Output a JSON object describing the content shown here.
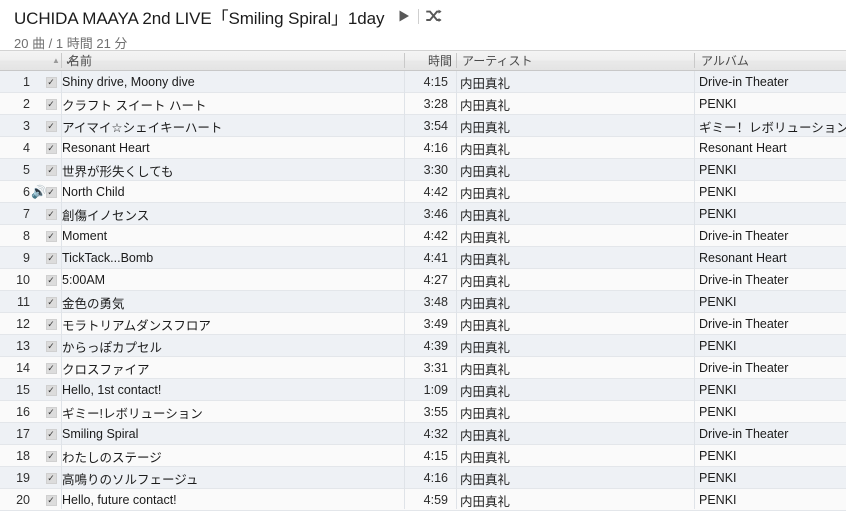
{
  "header": {
    "album_title": "UCHIDA MAAYA 2nd LIVE「Smiling  Spiral」1day",
    "subtitle": "20 曲 / 1 時間 21 分",
    "play_icon": "play-icon",
    "shuffle_icon": "shuffle-icon"
  },
  "columns": {
    "sort_arrow": "▲",
    "check": "✓",
    "name": "名前",
    "time": "時間",
    "artist": "アーティスト",
    "album": "アルバム"
  },
  "colors": {
    "row_odd": "#eef1f5",
    "row_even": "#fafafa",
    "header_bg": "#ececec",
    "text": "#1b1b1b",
    "subtitle_text": "#707070"
  },
  "tracks": [
    {
      "num": "1",
      "checked": "✓",
      "playing": "",
      "name": "Shiny drive, Moony dive",
      "time": "4:15",
      "artist": "内田真礼",
      "album": "Drive-in Theater"
    },
    {
      "num": "2",
      "checked": "✓",
      "playing": "",
      "name": "クラフト スイート ハート",
      "time": "3:28",
      "artist": "内田真礼",
      "album": "PENKI"
    },
    {
      "num": "3",
      "checked": "✓",
      "playing": "",
      "name": "アイマイ☆シェイキーハート",
      "time": "3:54",
      "artist": "内田真礼",
      "album": "ギミー！レボリューション"
    },
    {
      "num": "4",
      "checked": "✓",
      "playing": "",
      "name": "Resonant Heart",
      "time": "4:16",
      "artist": "内田真礼",
      "album": "Resonant Heart"
    },
    {
      "num": "5",
      "checked": "✓",
      "playing": "",
      "name": "世界が形失くしても",
      "time": "3:30",
      "artist": "内田真礼",
      "album": "PENKI"
    },
    {
      "num": "6",
      "checked": "✓",
      "playing": "🔊",
      "name": "North Child",
      "time": "4:42",
      "artist": "内田真礼",
      "album": "PENKI"
    },
    {
      "num": "7",
      "checked": "✓",
      "playing": "",
      "name": "創傷イノセンス",
      "time": "3:46",
      "artist": "内田真礼",
      "album": "PENKI"
    },
    {
      "num": "8",
      "checked": "✓",
      "playing": "",
      "name": "Moment",
      "time": "4:42",
      "artist": "内田真礼",
      "album": "Drive-in Theater"
    },
    {
      "num": "9",
      "checked": "✓",
      "playing": "",
      "name": "TickTack...Bomb",
      "time": "4:41",
      "artist": "内田真礼",
      "album": "Resonant Heart"
    },
    {
      "num": "10",
      "checked": "✓",
      "playing": "",
      "name": "5:00AM",
      "time": "4:27",
      "artist": "内田真礼",
      "album": "Drive-in Theater"
    },
    {
      "num": "11",
      "checked": "✓",
      "playing": "",
      "name": "金色の勇気",
      "time": "3:48",
      "artist": "内田真礼",
      "album": "PENKI"
    },
    {
      "num": "12",
      "checked": "✓",
      "playing": "",
      "name": "モラトリアムダンスフロア",
      "time": "3:49",
      "artist": "内田真礼",
      "album": "Drive-in Theater"
    },
    {
      "num": "13",
      "checked": "✓",
      "playing": "",
      "name": "からっぽカプセル",
      "time": "4:39",
      "artist": "内田真礼",
      "album": "PENKI"
    },
    {
      "num": "14",
      "checked": "✓",
      "playing": "",
      "name": "クロスファイア",
      "time": "3:31",
      "artist": "内田真礼",
      "album": "Drive-in Theater"
    },
    {
      "num": "15",
      "checked": "✓",
      "playing": "",
      "name": "Hello, 1st contact!",
      "time": "1:09",
      "artist": "内田真礼",
      "album": "PENKI"
    },
    {
      "num": "16",
      "checked": "✓",
      "playing": "",
      "name": "ギミー!レボリューション",
      "time": "3:55",
      "artist": "内田真礼",
      "album": "PENKI"
    },
    {
      "num": "17",
      "checked": "✓",
      "playing": "",
      "name": "Smiling Spiral",
      "time": "4:32",
      "artist": "内田真礼",
      "album": "Drive-in Theater"
    },
    {
      "num": "18",
      "checked": "✓",
      "playing": "",
      "name": "わたしのステージ",
      "time": "4:15",
      "artist": "内田真礼",
      "album": "PENKI"
    },
    {
      "num": "19",
      "checked": "✓",
      "playing": "",
      "name": "高鳴りのソルフェージュ",
      "time": "4:16",
      "artist": "内田真礼",
      "album": "PENKI"
    },
    {
      "num": "20",
      "checked": "✓",
      "playing": "",
      "name": "Hello, future contact!",
      "time": "4:59",
      "artist": "内田真礼",
      "album": "PENKI"
    }
  ]
}
